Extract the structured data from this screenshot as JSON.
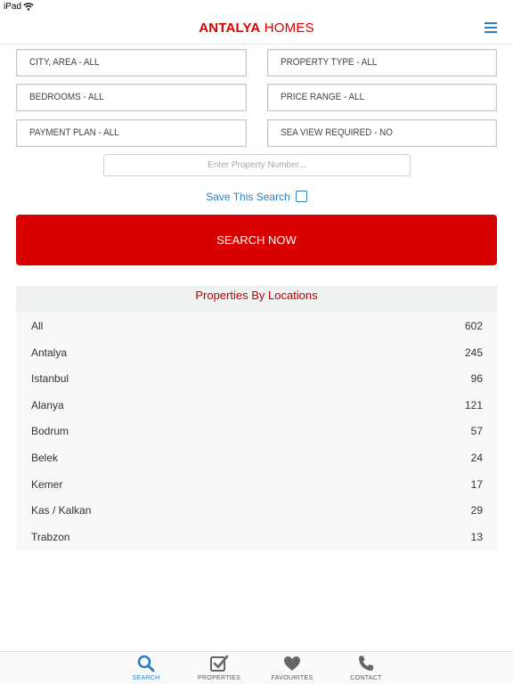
{
  "status_bar": {
    "device": "iPad"
  },
  "header": {
    "logo_part1": "ANTALYA",
    "logo_part2": " HOMES"
  },
  "filters": {
    "city_area": "CITY, AREA - ALL",
    "property_type": "PROPERTY TYPE - ALL",
    "bedrooms": "BEDROOMS - ALL",
    "price_range": "PRICE RANGE - ALL",
    "payment_plan": "PAYMENT PLAN - ALL",
    "sea_view": "SEA VIEW REQUIRED - NO"
  },
  "property_number": {
    "placeholder": "Enter Property Number..."
  },
  "save_search": {
    "label": "Save This Search",
    "checked": false
  },
  "search_button": "SEARCH NOW",
  "locations": {
    "title": "Properties By Locations",
    "items": [
      {
        "name": "All",
        "count": "602"
      },
      {
        "name": "Antalya",
        "count": "245"
      },
      {
        "name": "Istanbul",
        "count": "96"
      },
      {
        "name": "Alanya",
        "count": "121"
      },
      {
        "name": "Bodrum",
        "count": "57"
      },
      {
        "name": "Belek",
        "count": "24"
      },
      {
        "name": "Kemer",
        "count": "17"
      },
      {
        "name": "Kas / Kalkan",
        "count": "29"
      },
      {
        "name": "Trabzon",
        "count": "13"
      }
    ]
  },
  "tabs": [
    {
      "label": "SEARCH",
      "icon": "search-icon",
      "active": true
    },
    {
      "label": "PROPERTIES",
      "icon": "checklist-icon",
      "active": false
    },
    {
      "label": "FAVOURITES",
      "icon": "heart-icon",
      "active": false
    },
    {
      "label": "CONTACT",
      "icon": "phone-icon",
      "active": false
    }
  ],
  "colors": {
    "brand_red": "#d90000",
    "accent_blue": "#2a7fc7"
  }
}
